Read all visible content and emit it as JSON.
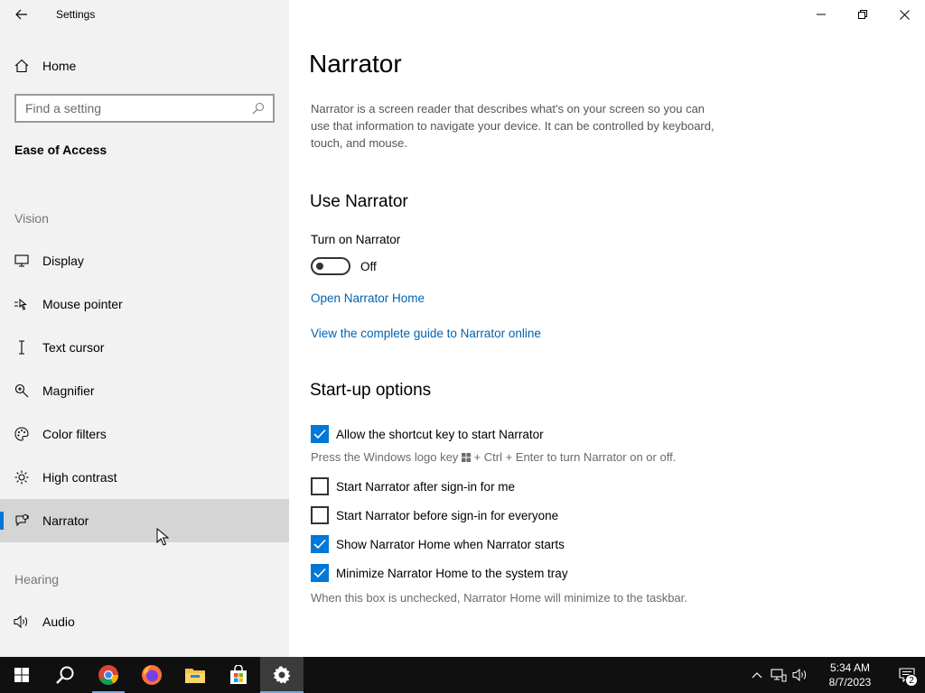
{
  "app": {
    "title": "Settings"
  },
  "sidebar": {
    "home_label": "Home",
    "search_placeholder": "Find a setting",
    "section_heading": "Ease of Access",
    "groups": {
      "vision": "Vision",
      "hearing": "Hearing"
    },
    "items": [
      {
        "label": "Display",
        "icon": "monitor-icon"
      },
      {
        "label": "Mouse pointer",
        "icon": "mouse-pointer-icon"
      },
      {
        "label": "Text cursor",
        "icon": "text-cursor-icon"
      },
      {
        "label": "Magnifier",
        "icon": "magnifier-icon"
      },
      {
        "label": "Color filters",
        "icon": "palette-icon"
      },
      {
        "label": "High contrast",
        "icon": "high-contrast-icon"
      },
      {
        "label": "Narrator",
        "icon": "narrator-icon",
        "selected": true
      },
      {
        "label": "Audio",
        "icon": "speaker-icon"
      }
    ]
  },
  "main": {
    "title": "Narrator",
    "description": "Narrator is a screen reader that describes what's on your screen so you can use that information to navigate your device. It can be controlled by keyboard, touch, and mouse.",
    "use_narrator": {
      "heading": "Use Narrator",
      "toggle_label": "Turn on Narrator",
      "toggle_state": "Off",
      "toggle_on": false,
      "link_home": "Open Narrator Home",
      "link_guide": "View the complete guide to Narrator online"
    },
    "startup": {
      "heading": "Start-up options",
      "options": [
        {
          "label": "Allow the shortcut key to start Narrator",
          "checked": true
        },
        {
          "label": "Start Narrator after sign-in for me",
          "checked": false
        },
        {
          "label": "Start Narrator before sign-in for everyone",
          "checked": false
        },
        {
          "label": "Show Narrator Home when Narrator starts",
          "checked": true
        },
        {
          "label": "Minimize Narrator Home to the system tray",
          "checked": true
        }
      ],
      "shortcut_hint_before": "Press the Windows logo key",
      "shortcut_hint_after": "+ Ctrl + Enter to turn Narrator on or off.",
      "minimize_hint": "When this box is unchecked, Narrator Home will minimize to the taskbar."
    }
  },
  "taskbar": {
    "apps": [
      "start-icon",
      "search-icon",
      "chrome-icon",
      "firefox-icon",
      "file-explorer-icon",
      "store-icon",
      "settings-icon"
    ],
    "time": "5:34 AM",
    "date": "8/7/2023",
    "notification_count": "2"
  },
  "colors": {
    "accent": "#0078d7",
    "link": "#0063b1",
    "sidebar_bg": "#f2f2f2",
    "taskbar_bg": "#101010"
  }
}
